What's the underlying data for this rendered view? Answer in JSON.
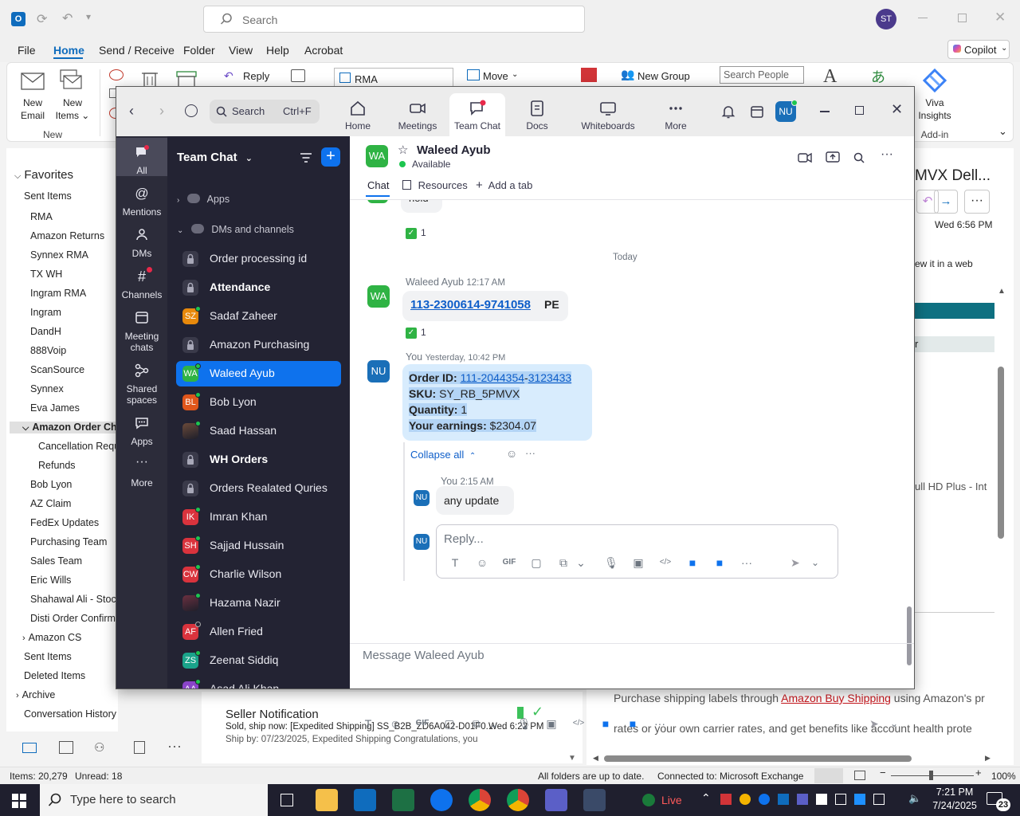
{
  "outlook": {
    "search_placeholder": "Search",
    "avatar_initials": "ST",
    "menu": [
      "File",
      "Home",
      "Send / Receive",
      "Folder",
      "View",
      "Help",
      "Acrobat"
    ],
    "copilot_label": "Copilot",
    "ribbon": {
      "new_email": "New\nEmail",
      "new_items": "New\nItems",
      "group_new": "New",
      "reply": "Reply",
      "rma_box": "RMA",
      "move": "Move",
      "new_group": "New Group",
      "search_people_placeholder": "Search People",
      "viva_insights": "Viva\nInsights",
      "add_in": "Add-in"
    },
    "favorites_label": "Favorites",
    "folders": [
      "Sent Items",
      "RMA",
      "Amazon Returns",
      "Synnex RMA",
      "TX WH",
      "Ingram RMA",
      "Ingram",
      "DandH",
      "888Voip",
      "ScanSource",
      "Synnex",
      "Eva James",
      "Amazon Order Cho",
      "Cancellation Requ",
      "Refunds",
      "Bob Lyon",
      "AZ Claim",
      "FedEx Updates",
      "Purchasing Team",
      "Sales Team",
      "Eric Wills",
      "Shahawal Ali - Stock",
      "Disti Order Confirma",
      "Amazon CS",
      "Sent Items",
      "Deleted Items",
      "Archive",
      "Conversation History"
    ],
    "reading": {
      "subject_fragment": "MVX Dell...",
      "date": "Wed 6:56 PM",
      "view_web_fragment": "ew it in a web",
      "r_fragment": "r",
      "product_fragment": "ull HD Plus - Int",
      "body_line1_pre": "Purchase shipping labels through ",
      "body_link": "Amazon Buy Shipping",
      "body_line1_post": " using Amazon's pr",
      "body_line2": "rates or your own carrier rates, and get benefits like account health prote"
    },
    "list_item": {
      "sender": "Seller Notification",
      "preview1": "Sold, ship now: [Expedited Shipping] SS_B2B_ZD6A042-D01F0...",
      "date": "Wed 6:22 PM",
      "preview2": "Ship by: 07/23/2025, Expedited Shipping  Congratulations, you"
    },
    "status": {
      "items": "Items: 20,279",
      "unread": "Unread: 18",
      "sync": "All folders are up to date.",
      "connection": "Connected to: Microsoft Exchange",
      "zoom": "100%"
    }
  },
  "zoom": {
    "search_label": "Search",
    "search_shortcut": "Ctrl+F",
    "nav": [
      "Home",
      "Meetings",
      "Team Chat",
      "Docs",
      "Whiteboards",
      "More"
    ],
    "user_initials": "NU",
    "rail": [
      "All",
      "Mentions",
      "DMs",
      "Channels",
      "Meeting\nchats",
      "Shared\nspaces",
      "Apps",
      "More"
    ],
    "list_title": "Team Chat",
    "section_apps": "Apps",
    "section_dms": "DMs and channels",
    "channels": [
      {
        "name": "Order processing id",
        "av": "",
        "color": "#3a3a4a",
        "type": "lock",
        "bold": false,
        "status": "none"
      },
      {
        "name": "Attendance",
        "av": "",
        "color": "#3a3a4a",
        "type": "lock",
        "bold": true,
        "status": "none"
      },
      {
        "name": "Sadaf Zaheer",
        "av": "SZ",
        "color": "#e8890c",
        "type": "person",
        "bold": false,
        "status": "on"
      },
      {
        "name": "Amazon Purchasing",
        "av": "",
        "color": "#3a3a4a",
        "type": "lock",
        "bold": false,
        "status": "none"
      },
      {
        "name": "Waleed Ayub",
        "av": "WA",
        "color": "#2fb344",
        "type": "person",
        "bold": false,
        "status": "on"
      },
      {
        "name": "Bob Lyon",
        "av": "BL",
        "color": "#e0561b",
        "type": "person",
        "bold": false,
        "status": "on"
      },
      {
        "name": "Saad Hassan",
        "av": "",
        "color": "#6b4a3a",
        "type": "photo",
        "bold": false,
        "status": "on"
      },
      {
        "name": "WH Orders",
        "av": "",
        "color": "#3a3a4a",
        "type": "lock",
        "bold": true,
        "status": "none"
      },
      {
        "name": "Orders Realated Quries",
        "av": "",
        "color": "#3a3a4a",
        "type": "lock",
        "bold": false,
        "status": "none"
      },
      {
        "name": "Imran Khan",
        "av": "IK",
        "color": "#d9333d",
        "type": "person",
        "bold": false,
        "status": "on"
      },
      {
        "name": "Sajjad Hussain",
        "av": "SH",
        "color": "#d9333d",
        "type": "person",
        "bold": false,
        "status": "on"
      },
      {
        "name": "Charlie Wilson",
        "av": "CW",
        "color": "#d9333d",
        "type": "person",
        "bold": false,
        "status": "on"
      },
      {
        "name": "Hazama Nazir",
        "av": "",
        "color": "#6b3040",
        "type": "photo",
        "bold": false,
        "status": "on"
      },
      {
        "name": "Allen Fried",
        "av": "AF",
        "color": "#d9333d",
        "type": "person",
        "bold": false,
        "status": "off"
      },
      {
        "name": "Zeenat Siddiq",
        "av": "ZS",
        "color": "#1aa38a",
        "type": "person",
        "bold": false,
        "status": "on"
      },
      {
        "name": "Asad Ali Khan",
        "av": "AA",
        "color": "#8a44c8",
        "type": "person",
        "bold": false,
        "status": "on"
      }
    ],
    "chat": {
      "contact_initials": "WA",
      "contact_name": "Waleed Ayub",
      "contact_status": "Available",
      "tabs": [
        "Chat",
        "Resources",
        "Add a tab"
      ],
      "prev_fragment": "hold",
      "reaction_count": "1",
      "date_divider": "Today",
      "msg1": {
        "sender": "Waleed Ayub",
        "time": "12:17 AM",
        "link": "113-2300614-9741058",
        "suffix": "PE"
      },
      "msg2": {
        "sender": "You",
        "time": "Yesterday, 10:42 PM",
        "order_label": "Order ID:",
        "order_link_a": "111-2044354",
        "order_sep": "-",
        "order_link_b": "3123433",
        "sku_label": "SKU:",
        "sku": "SY_RB_5PMVX",
        "qty_label": "Quantity:",
        "qty": "1",
        "earn_label": "Your earnings:",
        "earn": "$2304.07"
      },
      "collapse": "Collapse all",
      "reply": {
        "sender": "You",
        "time": "2:15 AM",
        "text": "any update"
      },
      "reply_placeholder": "Reply...",
      "composer_placeholder": "Message Waleed Ayub"
    }
  },
  "taskbar": {
    "search_placeholder": "Type here to search",
    "live": "Live",
    "time": "7:21 PM",
    "date": "7/24/2025",
    "notif_count": "23"
  }
}
